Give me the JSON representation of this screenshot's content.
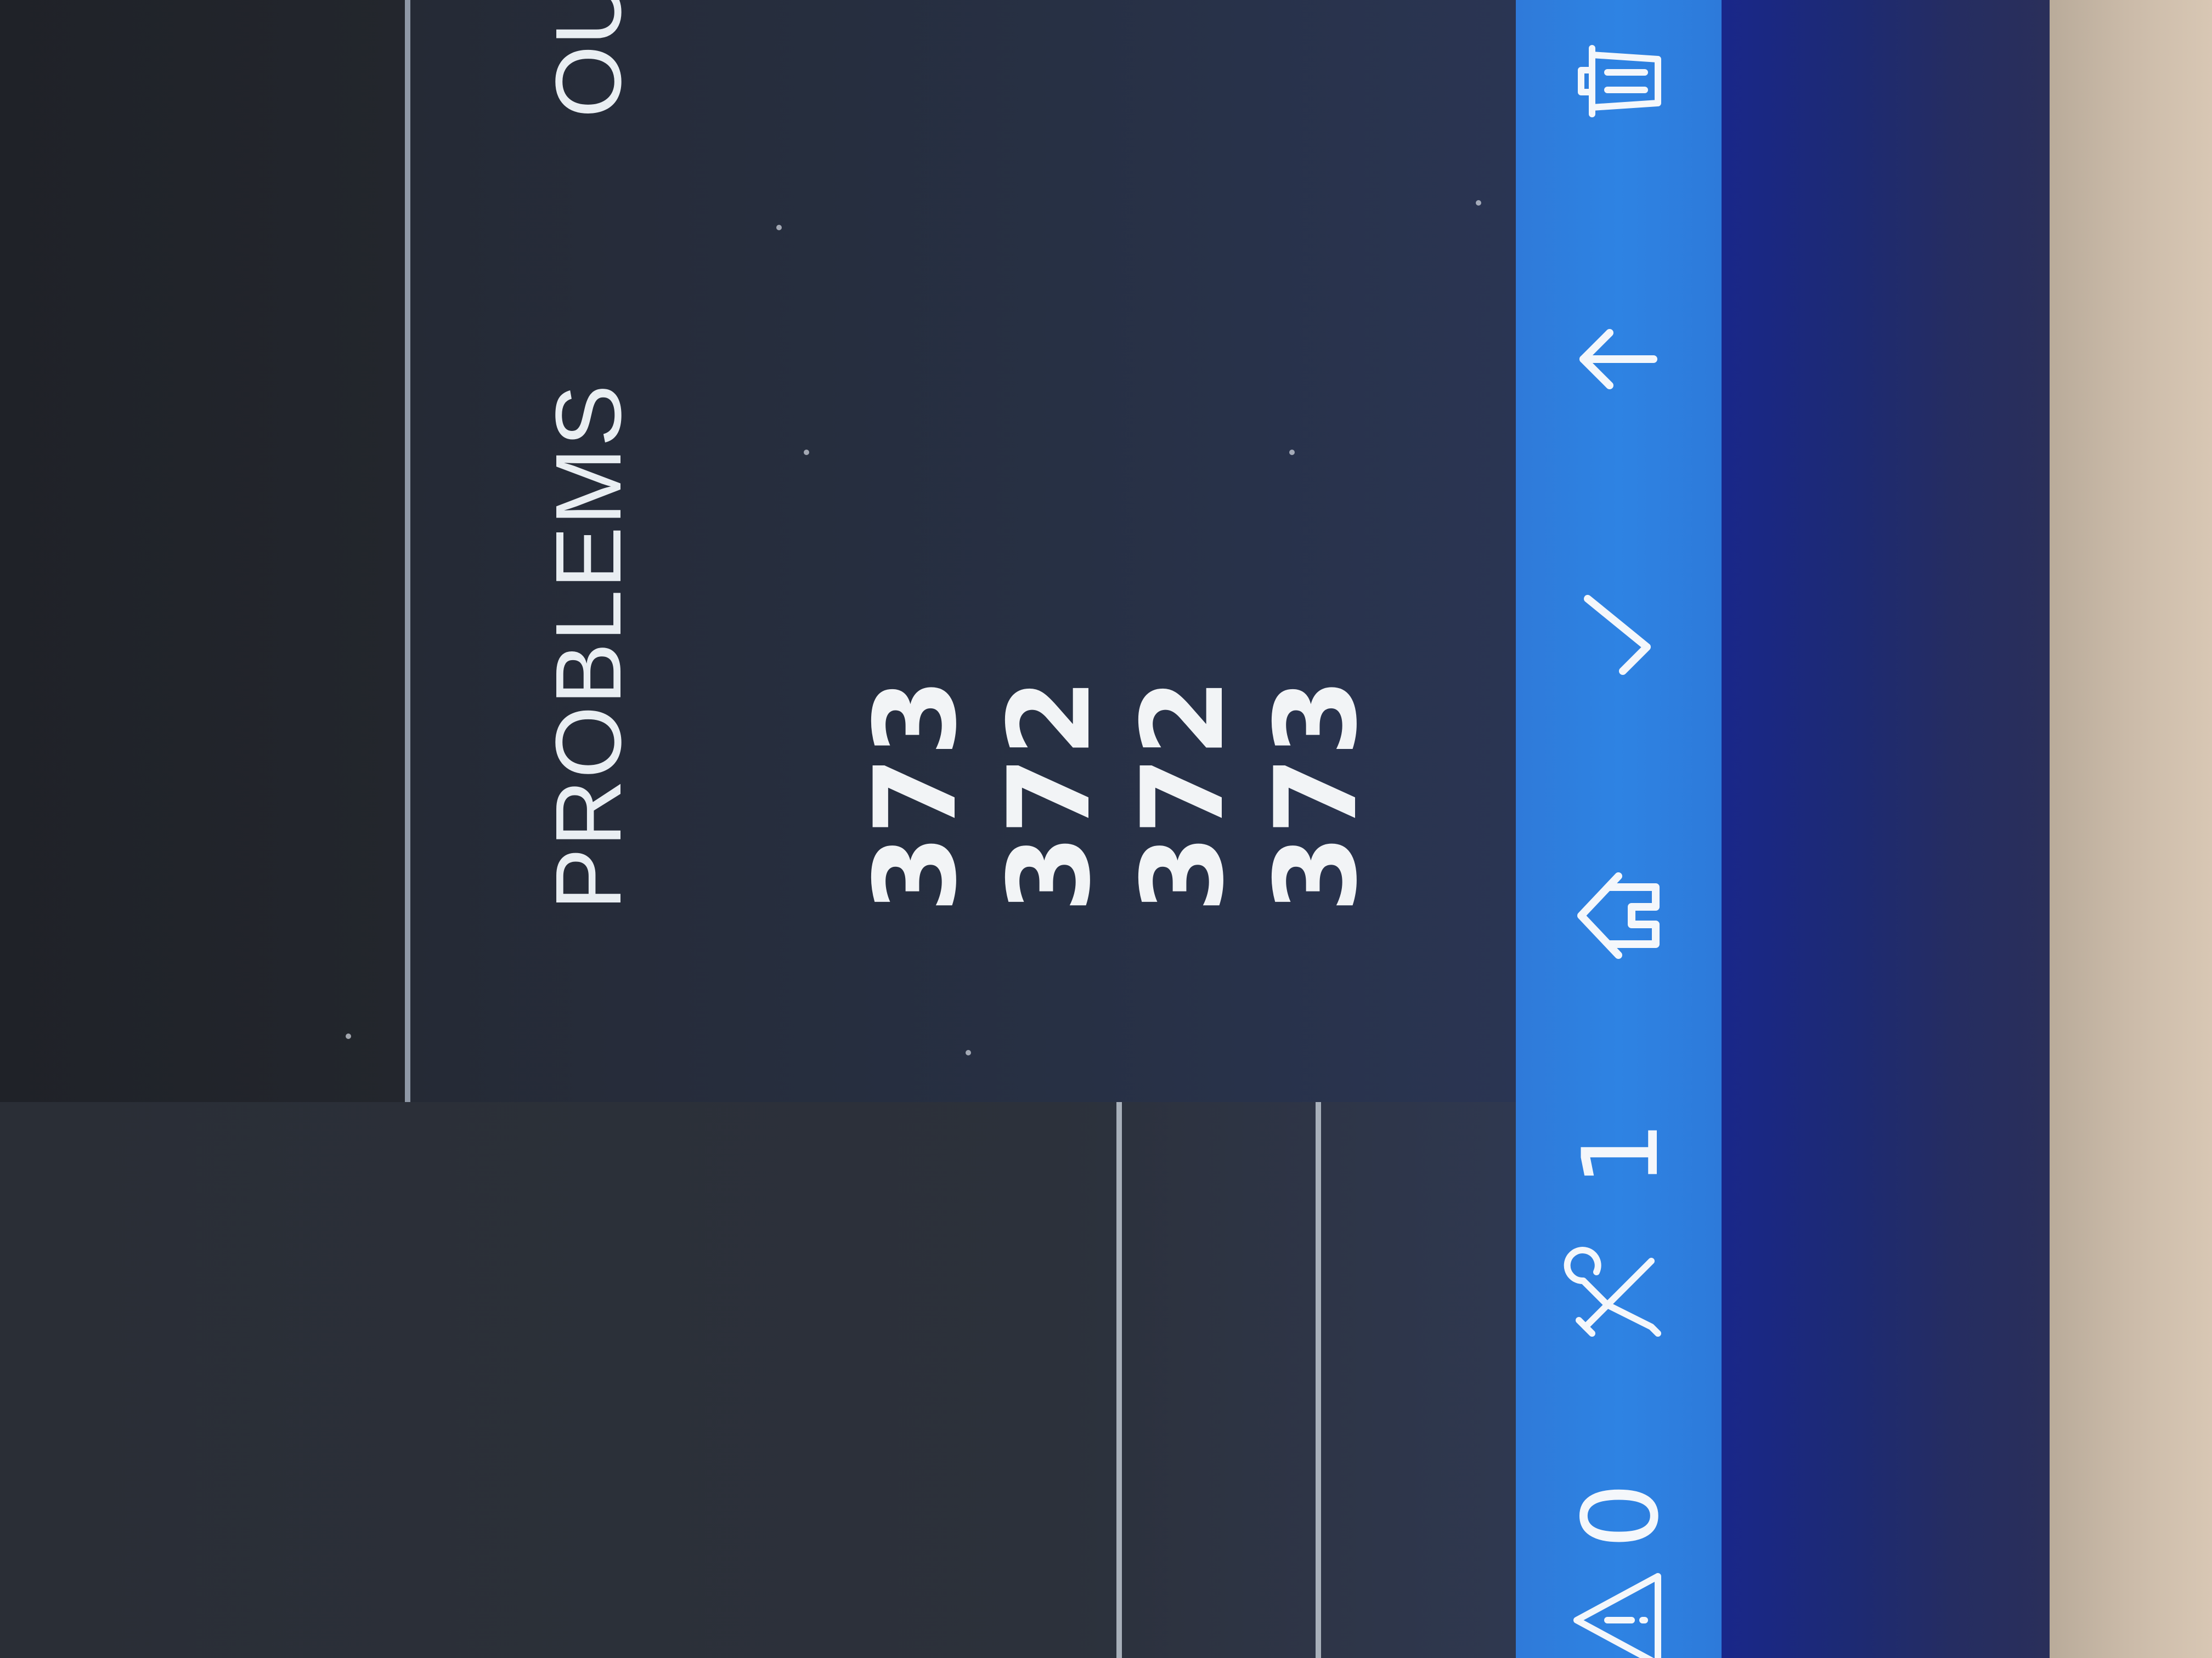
{
  "panel": {
    "tabs": [
      {
        "label": "PROBLEMS",
        "active": false
      },
      {
        "label": "OU",
        "active": false
      }
    ]
  },
  "terminal": {
    "lines": [
      "373",
      "372",
      "372",
      "373"
    ]
  },
  "status_bar": {
    "color": "#2f80e0",
    "items": [
      {
        "icon": "warning-icon",
        "label": "0"
      },
      {
        "icon": "tools-icon",
        "label": "1"
      },
      {
        "icon": "home-icon",
        "label": ""
      },
      {
        "icon": "check-icon",
        "label": ""
      },
      {
        "icon": "arrow-up-icon",
        "label": ""
      },
      {
        "icon": "trash-icon",
        "label": ""
      }
    ]
  }
}
